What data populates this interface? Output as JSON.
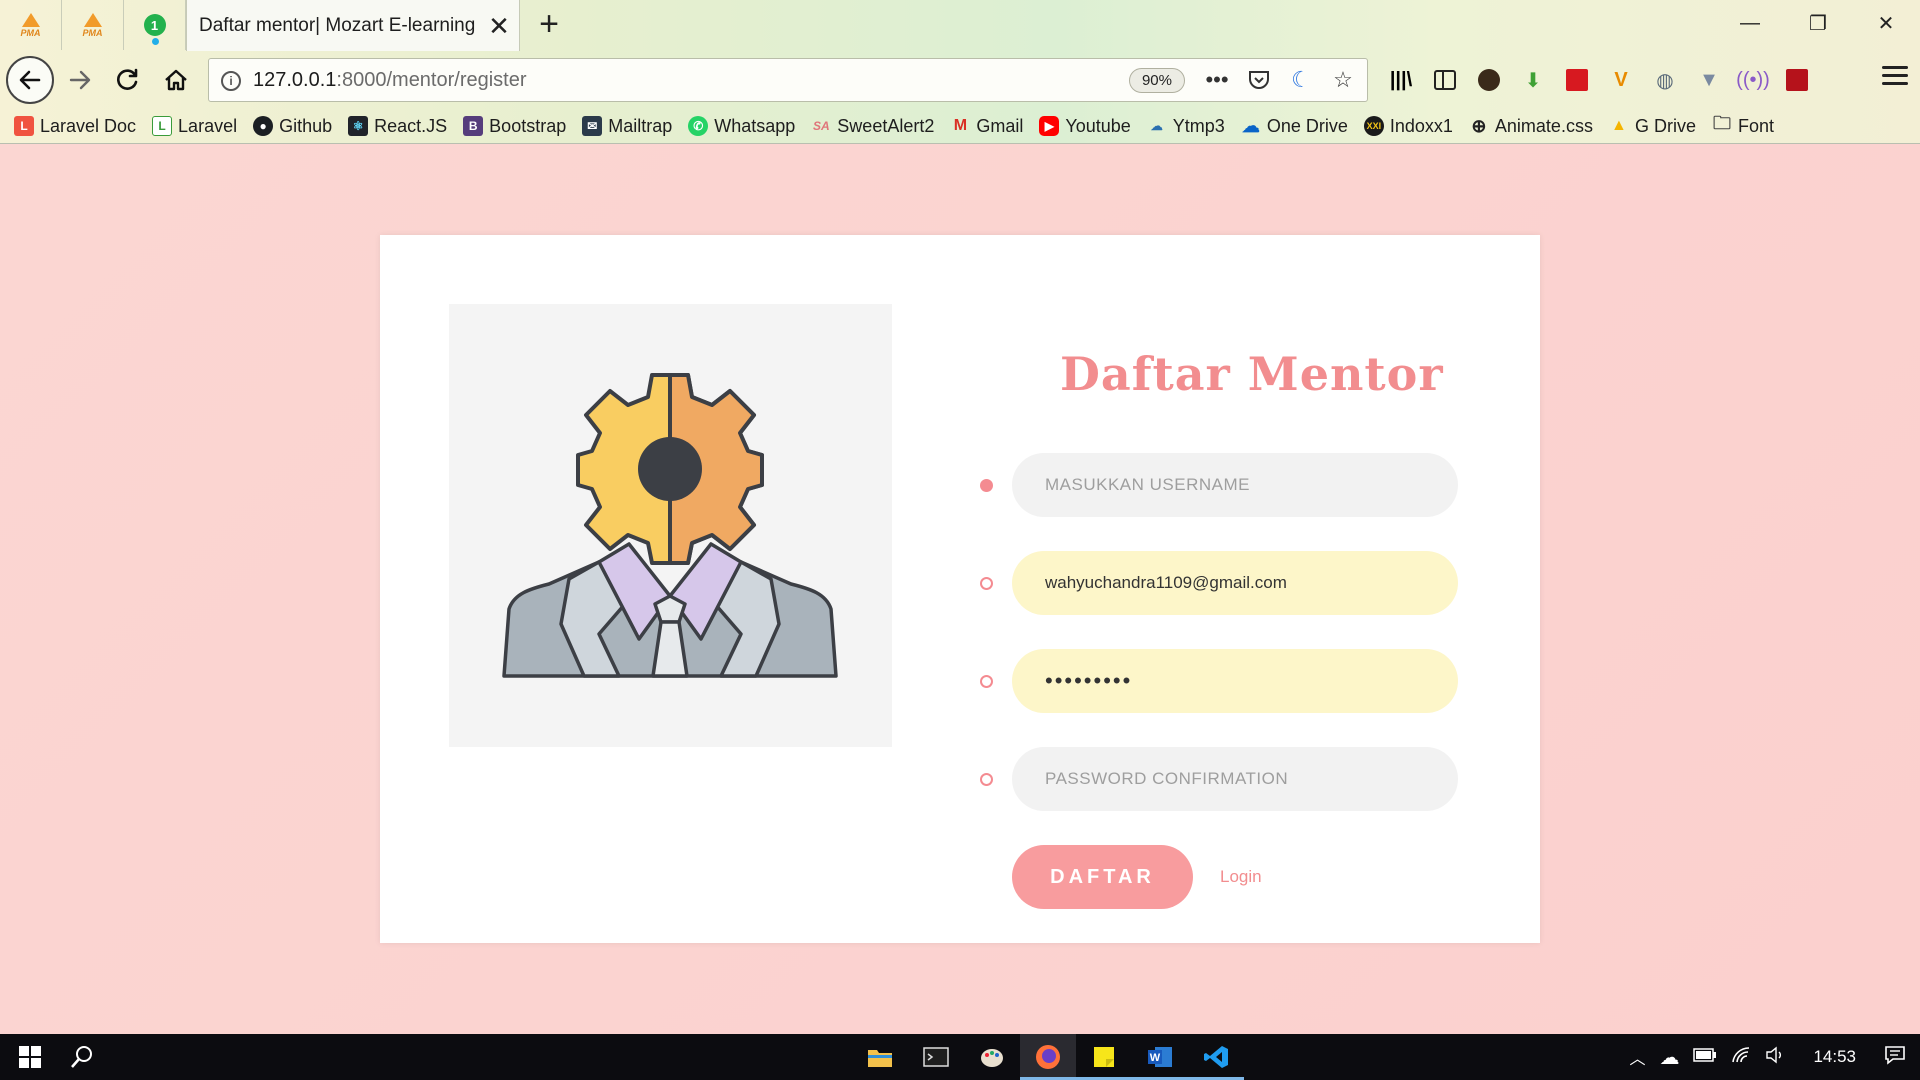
{
  "browser": {
    "tabs": {
      "pinned": [
        {
          "icon": "phpmyadmin-icon",
          "label": "PMA"
        },
        {
          "icon": "phpmyadmin-icon",
          "label": "PMA"
        },
        {
          "icon": "notification-badge-icon",
          "label": "1"
        }
      ],
      "active_title": "Daftar mentor| Mozart E-learning"
    },
    "url_host": "127.0.0.1",
    "url_path": ":8000/mentor/register",
    "zoom": "90%",
    "bookmarks": [
      {
        "label": "Laravel Doc",
        "icon": "laravel-icon",
        "color": "#f05340"
      },
      {
        "label": "Laravel",
        "icon": "laravel-icon",
        "color": "#ffffff"
      },
      {
        "label": "Github",
        "icon": "github-icon",
        "color": "#1b1f23"
      },
      {
        "label": "React.JS",
        "icon": "react-icon",
        "color": "#20232a"
      },
      {
        "label": "Bootstrap",
        "icon": "bootstrap-icon",
        "color": "#563d7c"
      },
      {
        "label": "Mailtrap",
        "icon": "mailtrap-icon",
        "color": "#2b3a4a"
      },
      {
        "label": "Whatsapp",
        "icon": "whatsapp-icon",
        "color": "#25d366"
      },
      {
        "label": "SweetAlert2",
        "icon": "sweetalert-icon",
        "color": "#ffffff"
      },
      {
        "label": "Gmail",
        "icon": "gmail-icon",
        "color": "#ffffff"
      },
      {
        "label": "Youtube",
        "icon": "youtube-icon",
        "color": "#ff0000"
      },
      {
        "label": "Ytmp3",
        "icon": "download-cloud-icon",
        "color": "#ffffff"
      },
      {
        "label": "One Drive",
        "icon": "onedrive-icon",
        "color": "#ffffff"
      },
      {
        "label": "Indoxx1",
        "icon": "indoxx-icon",
        "color": "#1a1a1a"
      },
      {
        "label": "Animate.css",
        "icon": "globe-icon",
        "color": "#ffffff"
      },
      {
        "label": "G Drive",
        "icon": "google-drive-icon",
        "color": "#ffffff"
      },
      {
        "label": "Font",
        "icon": "folder-icon",
        "color": "#ffffff"
      }
    ]
  },
  "form": {
    "title": "Daftar Mentor",
    "username_placeholder": "MASUKKAN USERNAME",
    "email_value": "wahyuchandra1109@gmail.com",
    "password_value": "•••••••••",
    "password_confirm_placeholder": "PASSWORD CONFIRMATION",
    "submit_label": "DAFTAR",
    "login_link": "Login"
  },
  "taskbar": {
    "clock": "14:53"
  },
  "colors": {
    "accent": "#f28d8f",
    "button": "#f89c9e",
    "page_bg": "#fbd3d1",
    "autofill": "#fdf6c9"
  }
}
